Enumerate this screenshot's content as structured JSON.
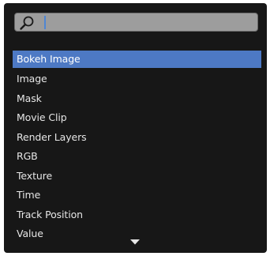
{
  "search": {
    "value": "",
    "icon": "search-icon"
  },
  "menu": {
    "items": [
      {
        "label": "Bokeh Image",
        "active": true
      },
      {
        "label": "Image",
        "active": false
      },
      {
        "label": "Mask",
        "active": false
      },
      {
        "label": "Movie Clip",
        "active": false
      },
      {
        "label": "Render Layers",
        "active": false
      },
      {
        "label": "RGB",
        "active": false
      },
      {
        "label": "Texture",
        "active": false
      },
      {
        "label": "Time",
        "active": false
      },
      {
        "label": "Track Position",
        "active": false
      },
      {
        "label": "Value",
        "active": false
      }
    ],
    "scroll_indicator_icon": "chevron-down-icon"
  },
  "colors": {
    "menu_background": "#171717",
    "highlight": "#4d79c4",
    "search_field": "#9d9d9d",
    "text": "#e6e6e6"
  }
}
